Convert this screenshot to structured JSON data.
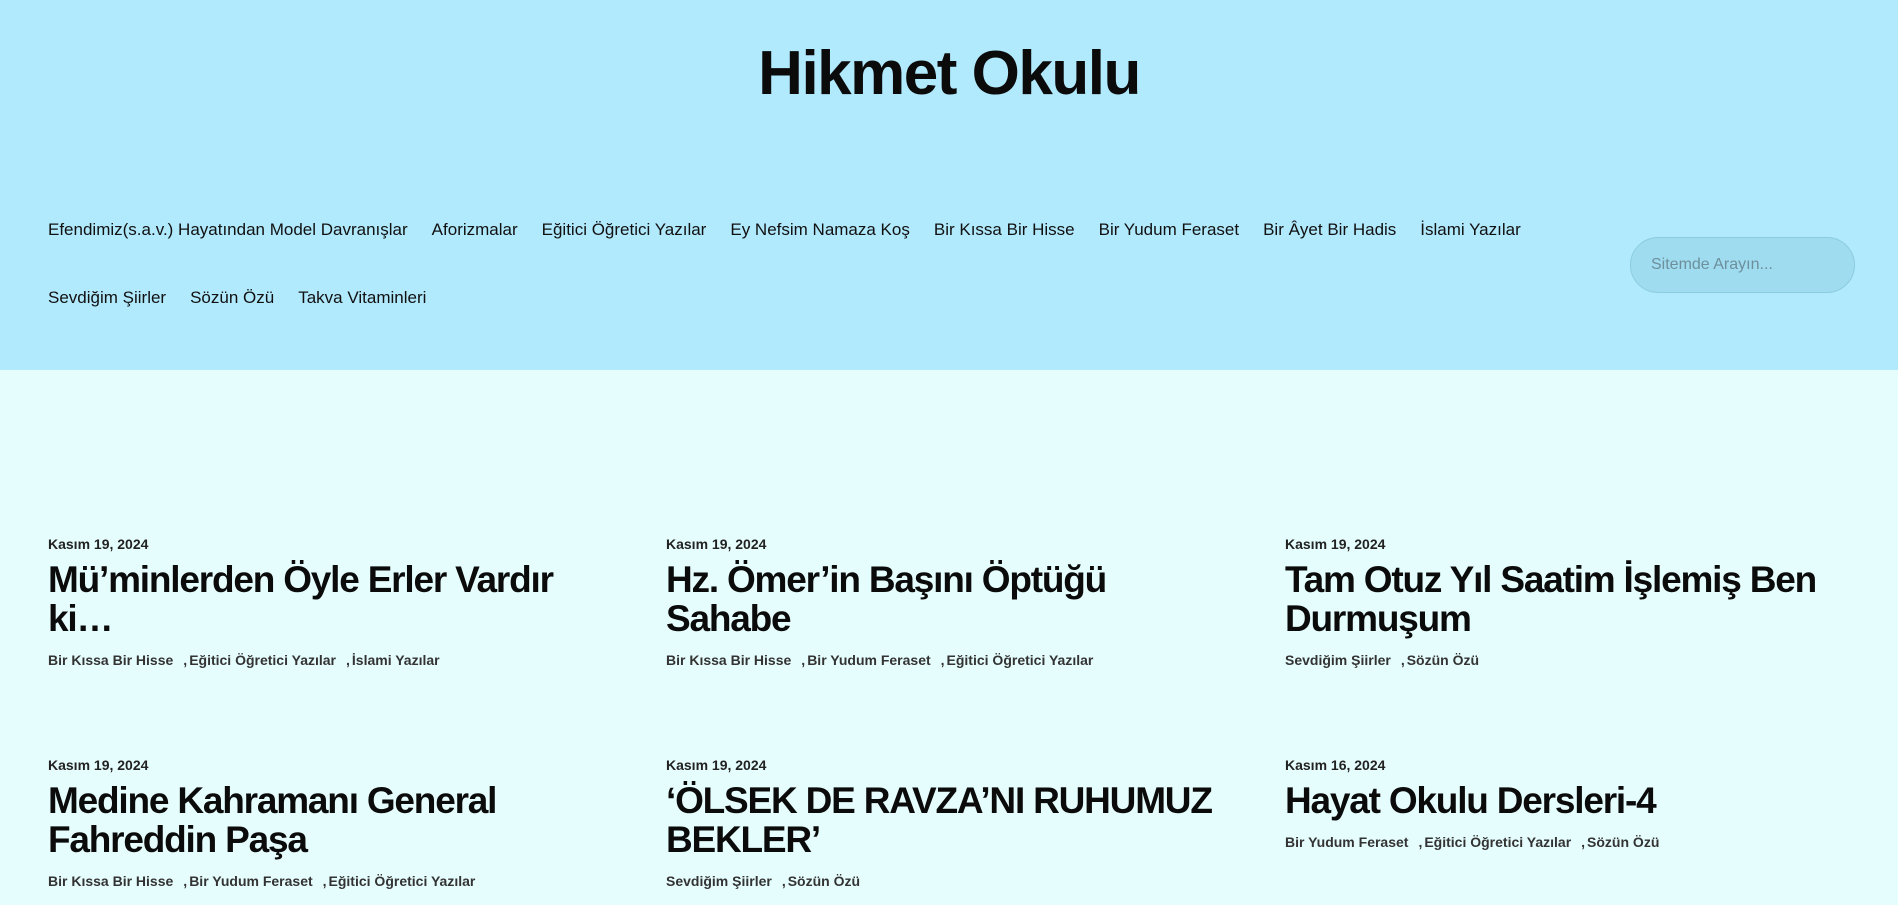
{
  "site": {
    "title": "Hikmet Okulu"
  },
  "nav": {
    "row1": [
      "Efendimiz(s.a.v.) Hayatından Model Davranışlar",
      "Aforizmalar",
      "Eğitici Öğretici Yazılar",
      "Ey Nefsim Namaza Koş",
      "Bir Kıssa Bir Hisse",
      "Bir Yudum Feraset",
      "Bir Âyet Bir Hadis",
      "İslami Yazılar"
    ],
    "row2": [
      "Sevdiğim Şiirler",
      "Sözün Özü",
      "Takva Vitaminleri"
    ]
  },
  "search": {
    "placeholder": "Sitemde Arayın..."
  },
  "posts": [
    {
      "date": "Kasım 19, 2024",
      "title": "Mü’minlerden Öyle Erler Vardır ki…",
      "cats": [
        "Bir Kıssa Bir Hisse",
        "Eğitici Öğretici Yazılar",
        "İslami Yazılar"
      ]
    },
    {
      "date": "Kasım 19, 2024",
      "title": "Hz. Ömer’in Başını Öptüğü Sahabe",
      "cats": [
        "Bir Kıssa Bir Hisse",
        "Bir Yudum Feraset",
        "Eğitici Öğretici Yazılar"
      ]
    },
    {
      "date": "Kasım 19, 2024",
      "title": "Tam Otuz Yıl Saatim İşlemiş Ben Durmuşum",
      "cats": [
        "Sevdiğim Şiirler",
        "Sözün Özü"
      ]
    },
    {
      "date": "Kasım 19, 2024",
      "title": "Medine Kahramanı General Fahreddin Paşa",
      "cats": [
        "Bir Kıssa Bir Hisse",
        "Bir Yudum Feraset",
        "Eğitici Öğretici Yazılar"
      ]
    },
    {
      "date": "Kasım 19, 2024",
      "title": "‘ÖLSEK DE RAVZA’NI RUHUMUZ BEKLER’",
      "cats": [
        "Sevdiğim Şiirler",
        "Sözün Özü"
      ]
    },
    {
      "date": "Kasım 16, 2024",
      "title": "Hayat Okulu Dersleri-4",
      "cats": [
        "Bir Yudum Feraset",
        "Eğitici Öğretici Yazılar",
        "Sözün Özü"
      ]
    }
  ]
}
